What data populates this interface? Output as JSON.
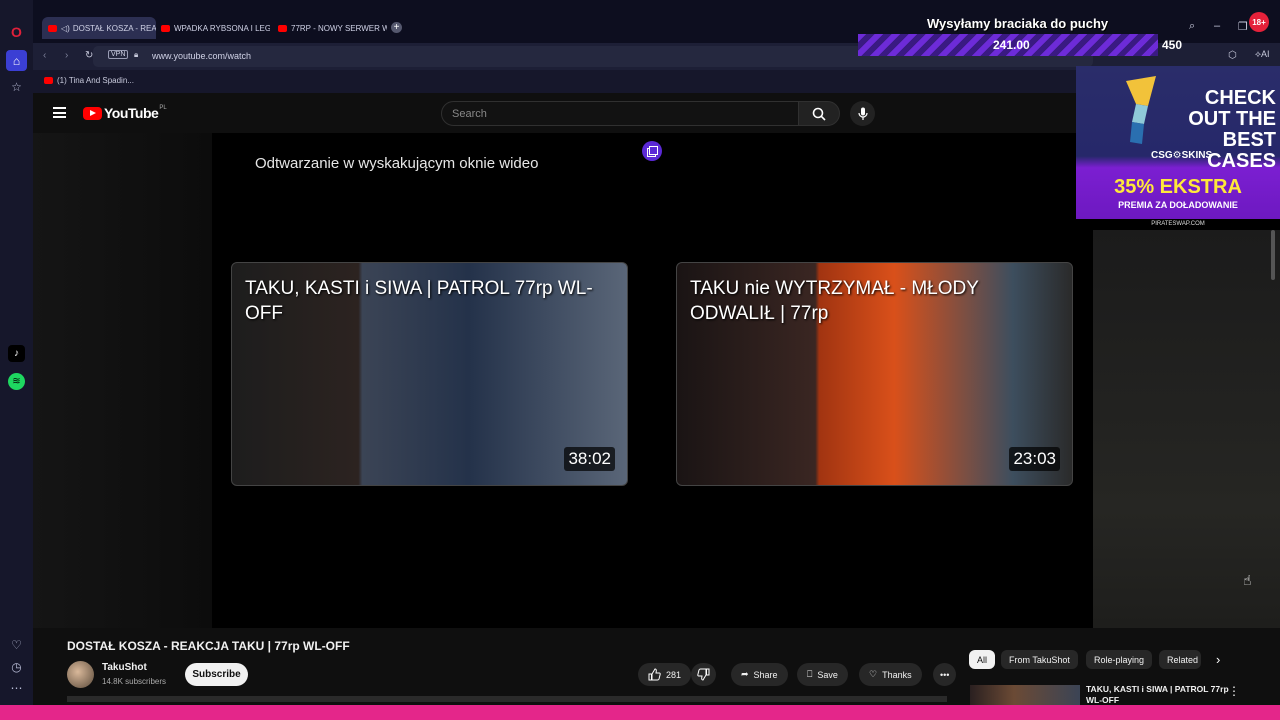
{
  "browser": {
    "tabs": [
      {
        "label": "DOSTAŁ KOSZA - REAK",
        "active": true
      },
      {
        "label": "WPADKA RYBSONA I LEG",
        "active": false
      },
      {
        "label": "77RP - NOWY SERWER W",
        "active": false
      }
    ],
    "new_tab": "+",
    "vpn_label": "VPN",
    "url": "www.youtube.com/watch",
    "bookmark": "(1) Tina And Spadin...",
    "ai_label": "AI"
  },
  "stream_overlay": {
    "title": "Wysyłamy braciaka do puchy",
    "goal_current": "241.00",
    "goal_target": "450",
    "age_badge": "18+"
  },
  "ad": {
    "headline": "CHECK OUT THE BEST CASES",
    "brand": "CSG⚙SKINS",
    "promo": "35% EKSTRA",
    "promo_sub": "PREMIA ZA DOŁADOWANIE",
    "footer": "PIRATESWAP.COM"
  },
  "youtube": {
    "logo_text": "YouTube",
    "country": "PL",
    "search_placeholder": "Search"
  },
  "player": {
    "pip_text": "Odtwarzanie w wyskakującym oknie wideo",
    "cards": [
      {
        "title": "TAKU, KASTI i SIWA | PATROL 77rp WL-OFF",
        "duration": "38:02"
      },
      {
        "title": "TAKU nie WYTRZYMAŁ - MŁODY ODWALIŁ | 77rp",
        "duration": "23:03"
      }
    ]
  },
  "video": {
    "title": "DOSTAŁ KOSZA - REAKCJA TAKU | 77rp WL-OFF",
    "channel": "TakuShot",
    "subscribers": "14.8K subscribers",
    "subscribe_label": "Subscribe",
    "likes": "281",
    "share_label": "Share",
    "save_label": "Save",
    "thanks_label": "Thanks"
  },
  "chips": [
    "All",
    "From TakuShot",
    "Role-playing",
    "Related"
  ],
  "related": [
    {
      "title": "TAKU, KASTI i SIWA | PATROL 77rp WL-OFF"
    }
  ],
  "colors": {
    "accent_pink": "#e4268a",
    "youtube_red": "#ff0000",
    "opera_red": "#e0203a",
    "purple": "#5b29d6"
  }
}
